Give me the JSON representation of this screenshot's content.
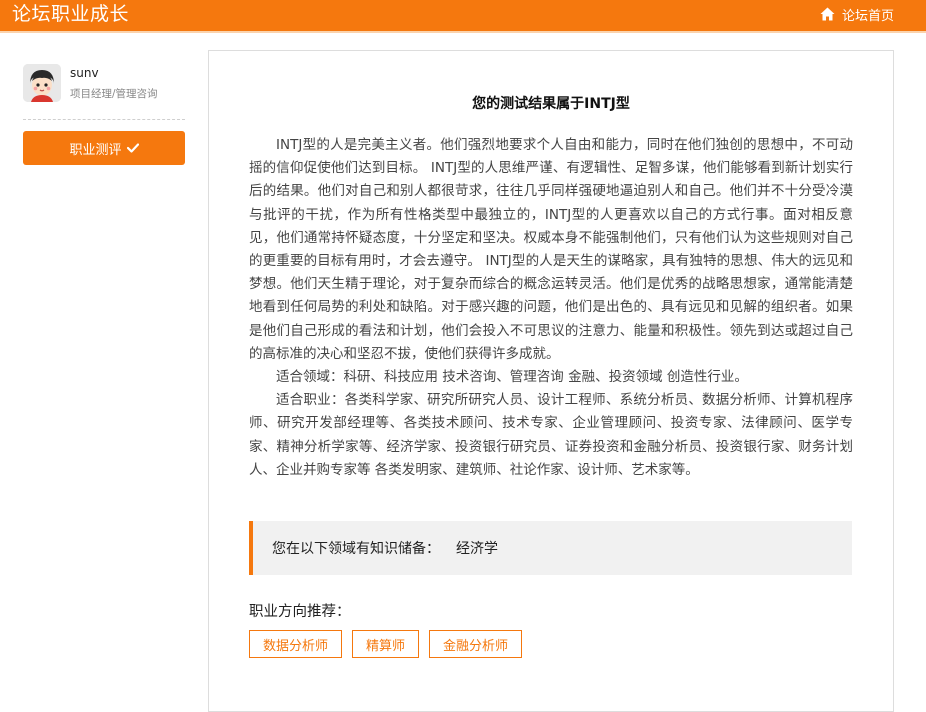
{
  "header": {
    "brand": "论坛职业成长",
    "home_label": "论坛首页",
    "home_icon": "home-icon",
    "accent_color": "#f5780e"
  },
  "user": {
    "name": "sunv",
    "title": "项目经理/管理咨询",
    "avatar_icon": "user-avatar-icon"
  },
  "sidebar": {
    "eval_button": "职业测评",
    "eval_icon": "check-icon"
  },
  "result": {
    "title": "您的测试结果属于INTJ型",
    "paragraphs": [
      "INTJ型的人是完美主义者。他们强烈地要求个人自由和能力，同时在他们独创的思想中，不可动摇的信仰促使他们达到目标。 INTJ型的人思维严谨、有逻辑性、足智多谋，他们能够看到新计划实行后的结果。他们对自己和别人都很苛求，往往几乎同样强硬地逼迫别人和自己。他们并不十分受冷漠与批评的干扰，作为所有性格类型中最独立的，INTJ型的人更喜欢以自己的方式行事。面对相反意见，他们通常持怀疑态度，十分坚定和坚决。权威本身不能强制他们，只有他们认为这些规则对自己的更重要的目标有用时，才会去遵守。 INTJ型的人是天生的谋略家，具有独特的思想、伟大的远见和梦想。他们天生精于理论，对于复杂而综合的概念运转灵活。他们是优秀的战略思想家，通常能清楚地看到任何局势的利处和缺陷。对于感兴趣的问题，他们是出色的、具有远见和见解的组织者。如果是他们自己形成的看法和计划，他们会投入不可思议的注意力、能量和积极性。领先到达或超过自己的高标准的决心和坚忍不拔，使他们获得许多成就。",
      "适合领域：科研、科技应用 技术咨询、管理咨询 金融、投资领域 创造性行业。",
      "适合职业：各类科学家、研究所研究人员、设计工程师、系统分析员、数据分析师、计算机程序师、研究开发部经理等、各类技术顾问、技术专家、企业管理顾问、投资专家、法律顾问、医学专家、精神分析学家等、经济学家、投资银行研究员、证券投资和金融分析员、投资银行家、财务计划人、企业并购专家等 各类发明家、建筑师、社论作家、设计师、艺术家等。"
    ]
  },
  "knowledge": {
    "label": "您在以下领域有知识储备：",
    "value": "经济学"
  },
  "recommend": {
    "label": "职业方向推荐：",
    "tags": [
      "数据分析师",
      "精算师",
      "金融分析师"
    ]
  }
}
